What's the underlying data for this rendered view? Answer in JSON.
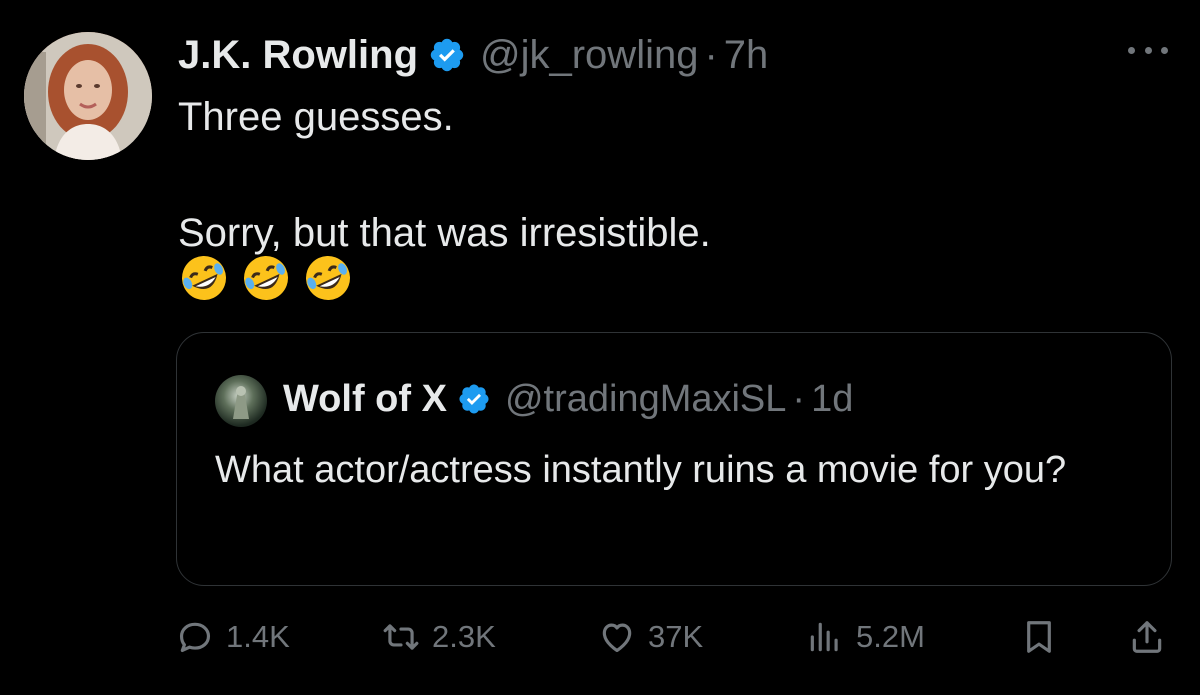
{
  "tweet": {
    "author_name": "J.K. Rowling",
    "handle": "@jk_rowling",
    "separator": "·",
    "time": "7h",
    "text_line1": "Three guesses.",
    "text_line2": "Sorry, but that was irresistible.",
    "emoji_icon": "rolling-on-floor-laughing-emoji"
  },
  "quoted_tweet": {
    "author_name": "Wolf of X",
    "handle": "@tradingMaxiSL",
    "separator": "·",
    "time": "1d",
    "text": "What actor/actress instantly ruins a movie for you?"
  },
  "actions": {
    "replies": "1.4K",
    "reposts": "2.3K",
    "likes": "37K",
    "views": "5.2M"
  },
  "icons": [
    "verified-badge-icon",
    "more-options-icon",
    "reply-icon",
    "repost-icon",
    "like-icon",
    "views-icon",
    "bookmark-icon",
    "share-icon"
  ],
  "colors": {
    "background": "#000000",
    "text_primary": "#e7e9ea",
    "text_secondary": "#71767b",
    "verified_blue": "#1d9bf0",
    "border": "#2f3336"
  }
}
